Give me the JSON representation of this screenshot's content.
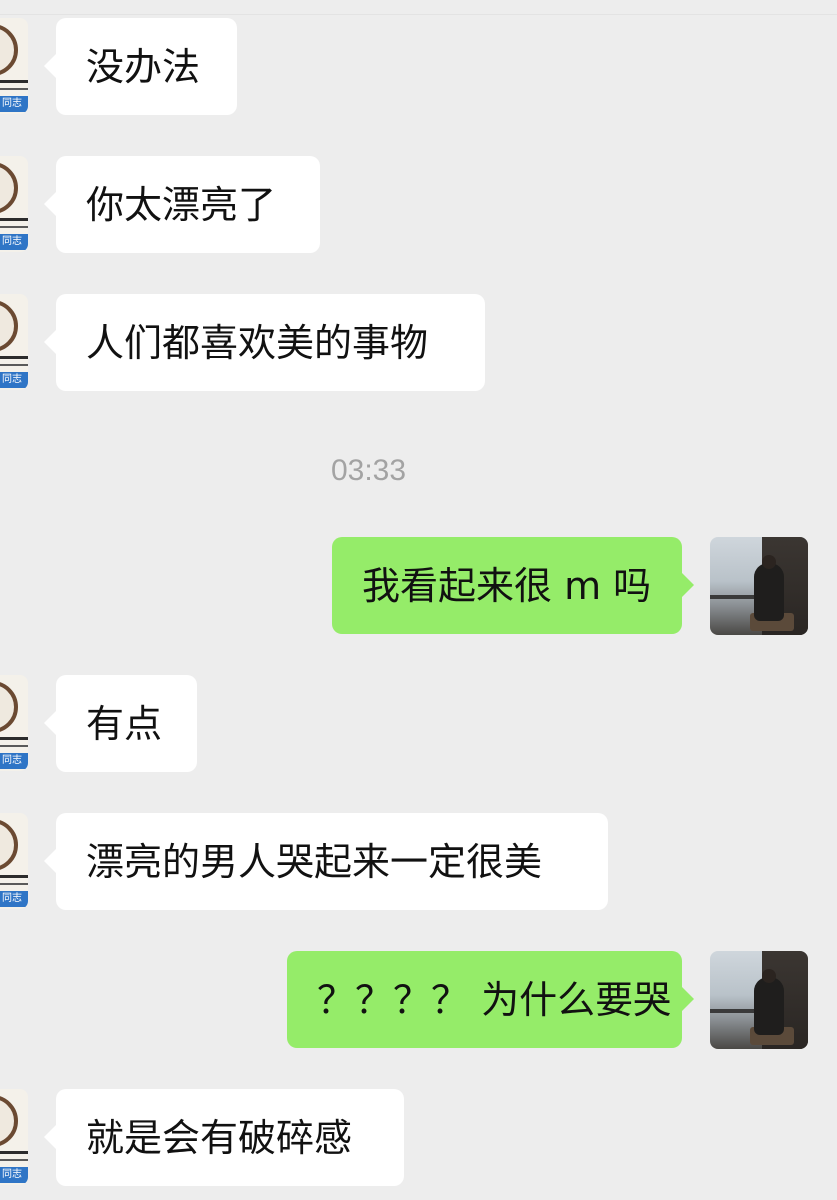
{
  "chat": {
    "timestamp": "03:33",
    "left_avatar_tag": "同志",
    "messages": [
      {
        "side": "in",
        "text": "没办法"
      },
      {
        "side": "in",
        "text": "你太漂亮了"
      },
      {
        "side": "in",
        "text": "人们都喜欢美的事物"
      },
      {
        "side": "out",
        "text": "我看起来很 m 吗"
      },
      {
        "side": "in",
        "text": "有点"
      },
      {
        "side": "in",
        "text": "漂亮的男人哭起来一定很美"
      },
      {
        "side": "out",
        "text": "？？？？ 为什么要哭"
      },
      {
        "side": "in",
        "text": "就是会有破碎感"
      }
    ]
  },
  "colors": {
    "background": "#ededed",
    "incoming_bubble": "#ffffff",
    "outgoing_bubble": "#95ec69",
    "timestamp_text": "#a3a3a3"
  }
}
